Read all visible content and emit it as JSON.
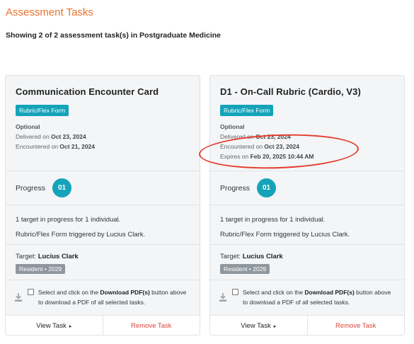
{
  "page": {
    "title": "Assessment Tasks",
    "summary": "Showing 2 of 2 assessment task(s) in Postgraduate Medicine"
  },
  "cards": [
    {
      "title": "Communication Encounter Card",
      "form_type": "Rubric/Flex Form",
      "optional_label": "Optional",
      "delivered_prefix": "Delivered on ",
      "delivered_date": "Oct 23, 2024",
      "encountered_prefix": "Encountered on ",
      "encountered_date": "Oct 21, 2024",
      "progress_label": "Progress",
      "progress_count": "01",
      "targets_text": "1 target in progress for 1 individual.",
      "trigger_text": "Rubric/Flex Form triggered by Lucius Clark.",
      "target_prefix": "Target: ",
      "target_name": "Lucius Clark",
      "target_badge": "Resident • 2029",
      "download_pre": "Select and click on the ",
      "download_bold": "Download PDF(s)",
      "download_post": " button above to download a PDF of all selected tasks.",
      "view_label": "View Task",
      "view_caret": "▸",
      "remove_label": "Remove Task"
    },
    {
      "title": "D1 - On-Call Rubric (Cardio, V3)",
      "form_type": "Rubric/Flex Form",
      "optional_label": "Optional",
      "delivered_prefix": "Delivered on ",
      "delivered_date": "Oct 23, 2024",
      "encountered_prefix": "Encountered on ",
      "encountered_date": "Oct 23, 2024",
      "expires_prefix": "Expires on ",
      "expires_date": "Feb 20, 2025 10:44 AM",
      "progress_label": "Progress",
      "progress_count": "01",
      "targets_text": "1 target in progress for 1 individual.",
      "trigger_text": "Rubric/Flex Form triggered by Lucius Clark.",
      "target_prefix": "Target: ",
      "target_name": "Lucius Clark",
      "target_badge": "Resident • 2029",
      "download_pre": "Select and click on the ",
      "download_bold": "Download PDF(s)",
      "download_post": " button above to download a PDF of all selected tasks.",
      "view_label": "View Task",
      "view_caret": "▸",
      "remove_label": "Remove Task"
    }
  ],
  "colors": {
    "title_orange": "#e8742a",
    "accent_teal": "#15a3b9",
    "remove_red": "#d9453b",
    "annotation_red": "#e53a2a"
  },
  "icons": [
    "download-icon",
    "checkbox-icon",
    "caret-right-icon"
  ]
}
